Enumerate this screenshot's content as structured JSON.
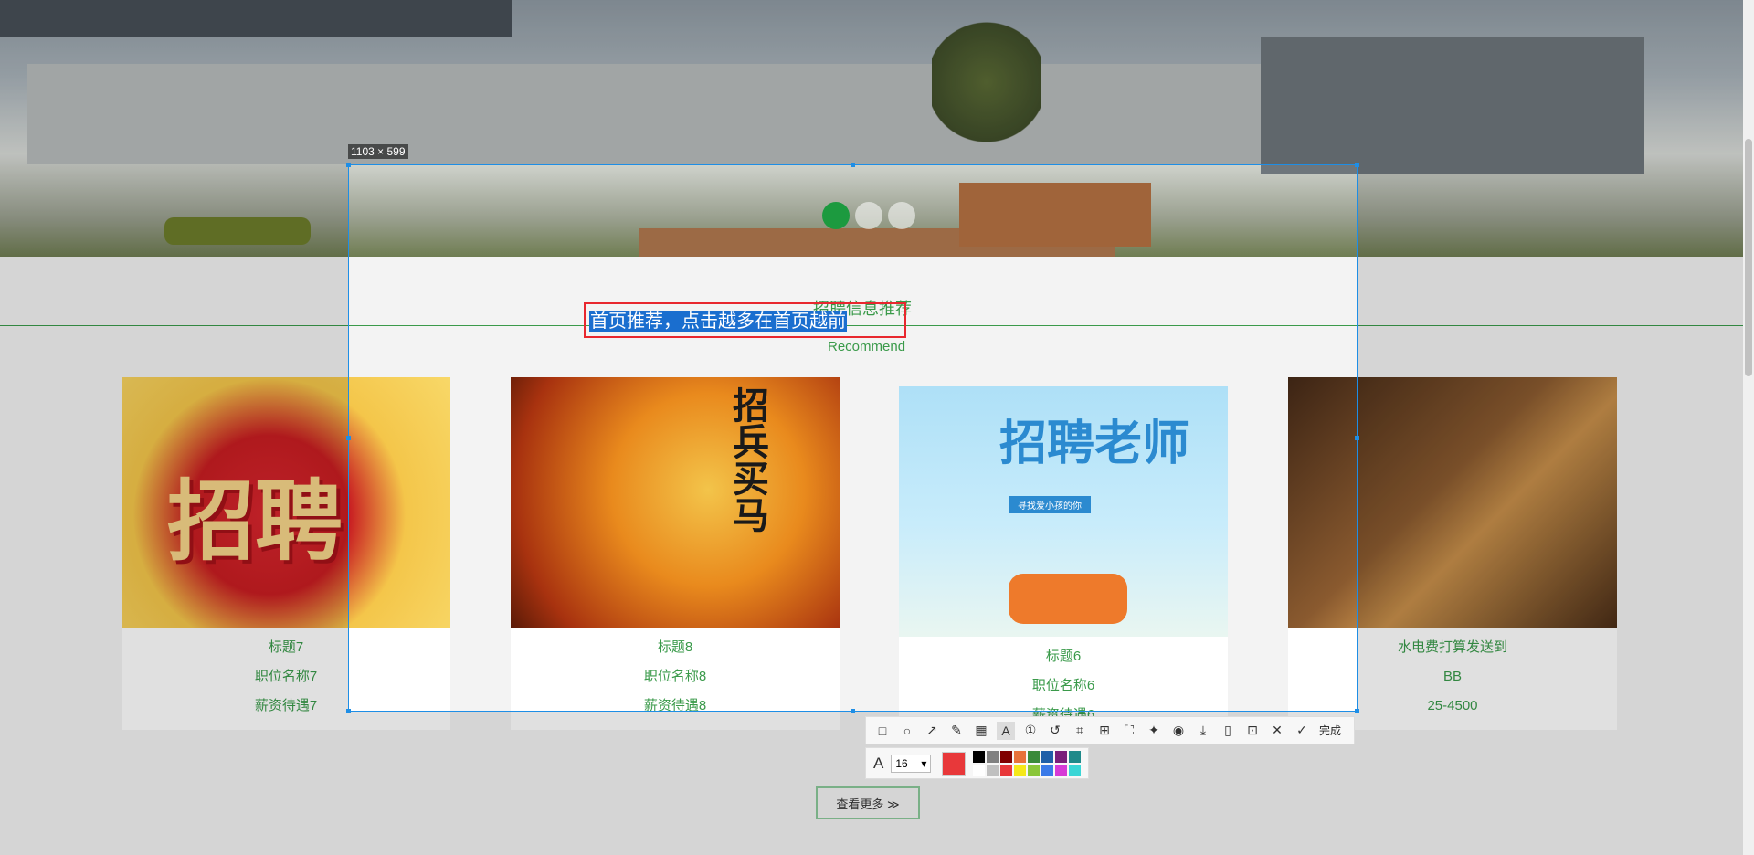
{
  "screenshot_tool": {
    "size_label": "1103 × 599",
    "annotation_text": "首页推荐，点击越多在首页越前",
    "font_size": "16",
    "done_label": "完成",
    "current_color": "#e8383a",
    "palette": [
      "#000000",
      "#808080",
      "#800000",
      "#e8713a",
      "#3a8a3a",
      "#1f5fa8",
      "#7a1f7a",
      "#1f8a8a",
      "#ffffff",
      "#c0c0c0",
      "#e8383a",
      "#f5e81a",
      "#8ac63a",
      "#3a7ae8",
      "#d63ad6",
      "#3ad6d6"
    ],
    "tools": [
      "rectangle-icon",
      "ellipse-icon",
      "arrow-icon",
      "pencil-icon",
      "mosaic-icon",
      "text-icon",
      "serial-number-icon",
      "undo-icon",
      "ocr-icon",
      "translate-icon",
      "scroll-capture-icon",
      "pin-icon",
      "record-icon",
      "download-icon",
      "copy-icon",
      "bookmark-icon",
      "close-icon",
      "check-icon"
    ]
  },
  "section": {
    "title": "招聘信息推荐",
    "subtitle": "Recommend"
  },
  "carousel": {
    "dot_count": 3,
    "active_index": 0
  },
  "cards": [
    {
      "title": "标题7",
      "position": "职位名称7",
      "salary": "薪资待遇7"
    },
    {
      "title": "标题8",
      "position": "职位名称8",
      "salary": "薪资待遇8"
    },
    {
      "title": "标题6",
      "position": "职位名称6",
      "salary": "薪资待遇6"
    },
    {
      "title": "水电费打算发送到",
      "position": "BB",
      "salary": "25-4500"
    }
  ],
  "posters": {
    "card1": "招聘",
    "card2": "招兵买马",
    "card3": "招聘老师",
    "card3_sub": "寻找爱小孩的你"
  },
  "more_button": "查看更多 ≫"
}
